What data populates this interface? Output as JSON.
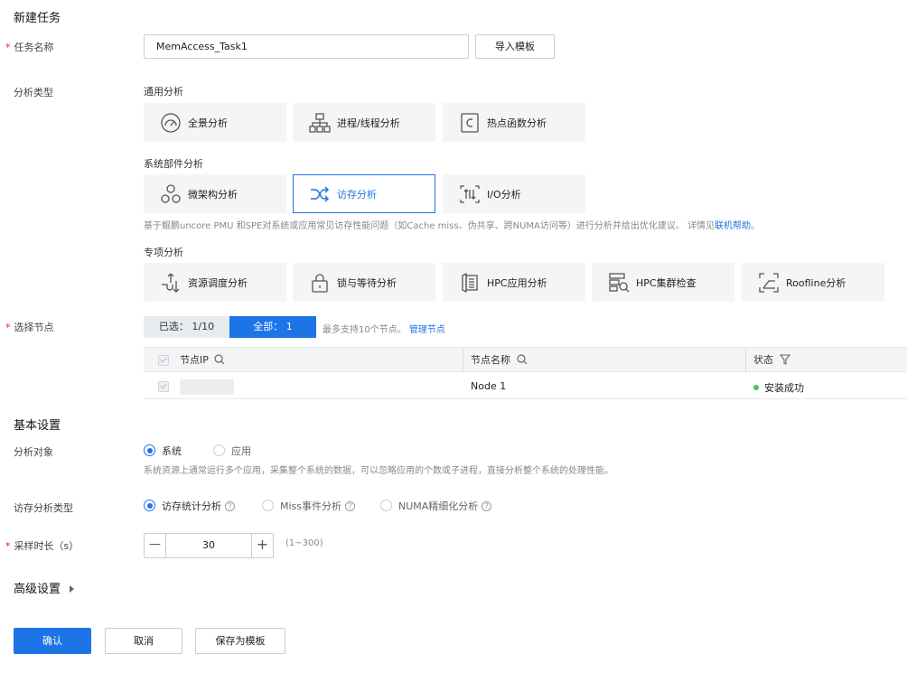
{
  "page": {
    "title": "新建任务"
  },
  "task_name": {
    "label": "任务名称",
    "value": "MemAccess_Task1",
    "import_button": "导入模板"
  },
  "analysis_type": {
    "label": "分析类型",
    "groups": [
      {
        "title": "通用分析",
        "items": [
          {
            "label": "全景分析",
            "icon": "gauge-icon"
          },
          {
            "label": "进程/线程分析",
            "icon": "hierarchy-icon"
          },
          {
            "label": "热点函数分析",
            "icon": "function-c-icon"
          }
        ]
      },
      {
        "title": "系统部件分析",
        "items": [
          {
            "label": "微架构分析",
            "icon": "molecule-icon"
          },
          {
            "label": "访存分析",
            "icon": "shuffle-icon",
            "selected": true
          },
          {
            "label": "I/O分析",
            "icon": "io-icon"
          }
        ]
      },
      {
        "title": "专项分析",
        "items": [
          {
            "label": "资源调度分析",
            "icon": "schedule-icon"
          },
          {
            "label": "锁与等待分析",
            "icon": "lock-icon"
          },
          {
            "label": "HPC应用分析",
            "icon": "hpc-app-icon"
          },
          {
            "label": "HPC集群检查",
            "icon": "cluster-check-icon"
          },
          {
            "label": "Roofline分析",
            "icon": "roofline-icon"
          }
        ]
      }
    ],
    "description": "基于鲲鹏uncore PMU 和SPE对系统或应用常见访存性能问题（如Cache miss、伪共享、跨NUMA访问等）进行分析并给出优化建议。 详情见",
    "help_link": "联机帮助",
    "help_suffix": "。"
  },
  "nodes": {
    "label": "选择节点",
    "selected_tab": {
      "label": "已选：",
      "count": "1/10"
    },
    "all_tab": {
      "label": "全部：",
      "count": "1"
    },
    "hint": "最多支持10个节点。",
    "manage_link": "管理节点",
    "columns": [
      "节点IP",
      "节点名称",
      "状态"
    ],
    "rows": [
      {
        "ip": "",
        "name": "Node 1",
        "status": "安装成功",
        "status_color": "#4cbf72"
      }
    ]
  },
  "basic": {
    "title": "基本设置",
    "target": {
      "label": "分析对象",
      "options": [
        "系统",
        "应用"
      ],
      "selected": 0,
      "description": "系统资源上通常运行多个应用，采集整个系统的数据，可以忽略应用的个数或子进程，直接分析整个系统的处理性能。"
    },
    "mem_type": {
      "label": "访存分析类型",
      "options": [
        "访存统计分析",
        "Miss事件分析",
        "NUMA精细化分析"
      ],
      "selected": 0
    },
    "duration": {
      "label": "采样时长（s）",
      "value": "30",
      "minus": "—",
      "plus": "+",
      "range": "(1~300)"
    }
  },
  "advanced": {
    "title": "高级设置"
  },
  "footer": {
    "confirm": "确认",
    "cancel": "取消",
    "save_template": "保存为模板"
  },
  "colors": {
    "accent": "#1d74e6",
    "required": "#e1251b",
    "success": "#4cbf72"
  }
}
